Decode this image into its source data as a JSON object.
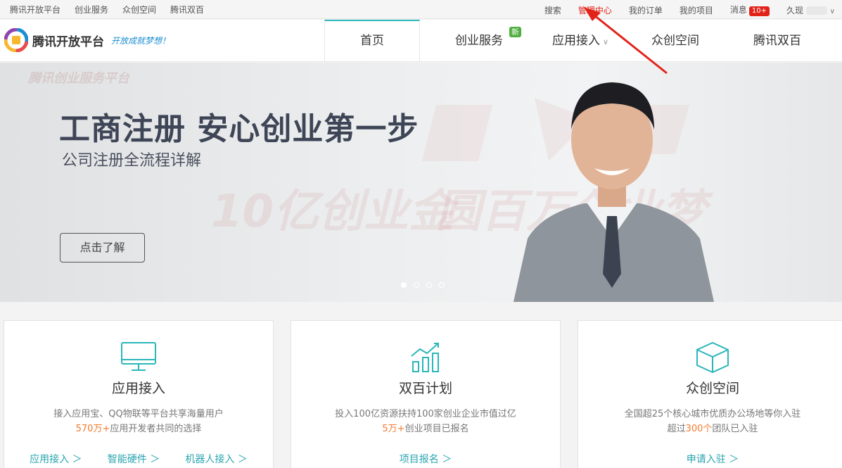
{
  "topbar": {
    "left_links": [
      "腾讯开放平台",
      "创业服务",
      "众创空间",
      "腾讯双百"
    ],
    "search": "搜索",
    "admin": "管理中心",
    "orders": "我的订单",
    "projects": "我的项目",
    "messages": "消息",
    "message_badge": "10+",
    "user": "久现"
  },
  "header": {
    "logo_text": "腾讯开放平台",
    "slogan": "开放成就梦想！",
    "nav": {
      "home": "首页",
      "services": "创业服务",
      "services_badge": "新",
      "app_access": "应用接入",
      "space": "众创空间",
      "double_hundred": "腾讯双百"
    }
  },
  "banner": {
    "title": "工商注册 安心创业第一步",
    "subtitle": "公司注册全流程详解",
    "button": "点击了解",
    "watermark_logo": "腾讯创业服务平台",
    "watermark_1": "10亿创业金",
    "watermark_2": "圆百万创业梦"
  },
  "cards": [
    {
      "title": "应用接入",
      "icon": "monitor-icon",
      "desc_line1": "接入应用宝、QQ物联等平台共享海量用户",
      "highlight": "570万+",
      "desc_line2_rest": "应用开发者共同的选择",
      "links": [
        "应用接入 ＞",
        "智能硬件 ＞",
        "机器人接入 ＞"
      ]
    },
    {
      "title": "双百计划",
      "icon": "bar-chart-icon",
      "desc_line1": "投入100亿资源扶持100家创业企业市值过亿",
      "highlight": "5万+",
      "desc_line2_rest": "创业项目已报名",
      "links": [
        "项目报名 ＞"
      ]
    },
    {
      "title": "众创空间",
      "icon": "cube-icon",
      "desc_line1": "全国超25个核心城市优质办公场地等你入驻",
      "desc_line2_prefix": "超过",
      "highlight": "300个",
      "desc_line2_rest": "团队已入驻",
      "links": [
        "申请入驻 ＞"
      ]
    }
  ],
  "colors": {
    "accent_teal": "#2bb6ba",
    "highlight_orange": "#f27a2e",
    "admin_red": "#e2231a"
  }
}
